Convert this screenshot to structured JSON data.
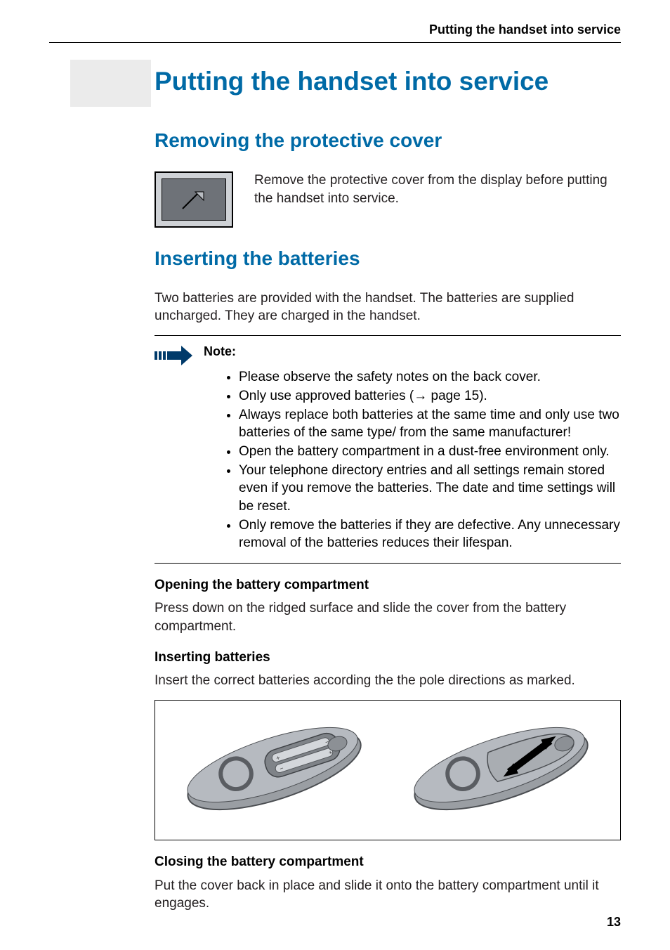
{
  "header": {
    "running_title": "Putting the handset into service"
  },
  "title": "Putting the handset into service",
  "sections": {
    "removing": {
      "heading": "Removing the protective cover",
      "paragraph": "Remove the protective cover from the display before putting the handset into service."
    },
    "inserting": {
      "heading": "Inserting the batteries",
      "intro": "Two batteries are provided with the handset. The batteries are supplied uncharged. They are charged in the handset.",
      "note": {
        "label": "Note:",
        "items": [
          "Please observe the safety notes on the back cover.",
          "Only use approved batteries (→ page 15).",
          "Always replace both batteries at the same time and only use two batteries of the same type/ from the same manufacturer!",
          "Open the battery compartment in a dust-free environment only.",
          "Your telephone directory entries and all settings remain stored even if you remove the batteries. The date and time settings will be reset.",
          "Only remove the batteries if they are defective. Any unnecessary removal of the batteries reduces their lifespan."
        ]
      },
      "opening": {
        "heading": "Opening the battery compartment",
        "paragraph": "Press down on the ridged surface and slide the cover from the battery compartment."
      },
      "insert": {
        "heading": "Inserting batteries",
        "paragraph": "Insert the correct batteries according the the pole directions as marked."
      },
      "closing": {
        "heading": "Closing the battery compartment",
        "paragraph": "Put the cover back in place and slide it onto the battery compartment until it engages."
      }
    }
  },
  "page_number": "13"
}
